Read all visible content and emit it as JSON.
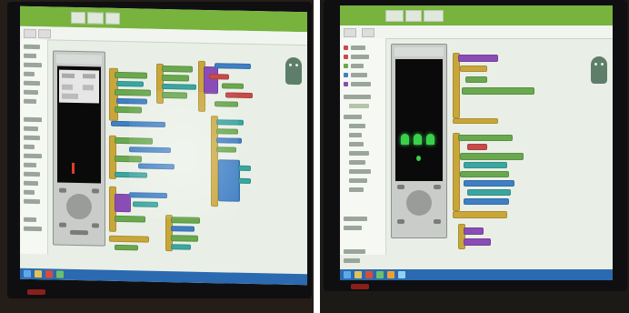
{
  "colors": {
    "topbar": "#77b33d",
    "taskbar": "#2b6ab0",
    "block_yellow": "#c9a63a",
    "block_green": "#6aa84f",
    "block_blue": "#3f7fc4",
    "block_teal": "#3ba6a0",
    "block_purple": "#8a4cb5",
    "invader_green": "#39d14b"
  },
  "icons": [
    "android-robot-icon",
    "emulator-dpad-icon",
    "windows-start-icon"
  ]
}
